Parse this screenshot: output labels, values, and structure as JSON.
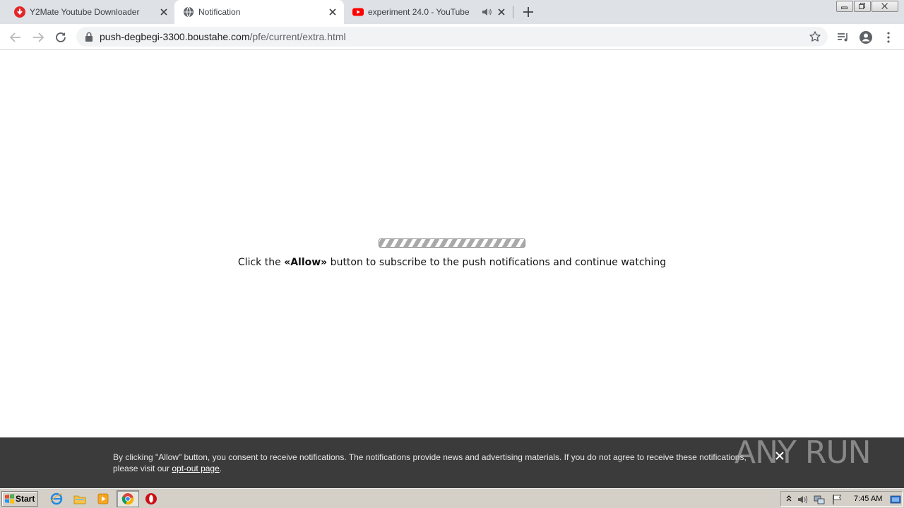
{
  "browser": {
    "tabs": [
      {
        "title": "Y2Mate Youtube Downloader",
        "active": false
      },
      {
        "title": "Notification",
        "active": true
      },
      {
        "title": "experiment 24.0 - YouTube",
        "active": false,
        "audio": true
      }
    ],
    "address": {
      "host": "push-degbegi-3300.boustahe.com",
      "path": "/pfe/current/extra.html"
    }
  },
  "page": {
    "message_before": "Click the ",
    "message_bold": "«Allow»",
    "message_after": " button to subscribe to the push notifications and continue watching"
  },
  "banner": {
    "text": "By clicking \"Allow\" button, you consent to receive notifications. The notifications provide news and advertising materials. If you do not agree to receive these notifications, please visit our ",
    "link": "opt-out page",
    "suffix": "."
  },
  "watermark": {
    "text": "ANY RUN"
  },
  "taskbar": {
    "start_label": "Start",
    "clock": "7:45 AM"
  },
  "colors": {
    "tabstrip": "#dee1e6",
    "banner": "#3b3b3b",
    "youtube_red": "#ff0000",
    "y2mate_red": "#e4262a"
  }
}
